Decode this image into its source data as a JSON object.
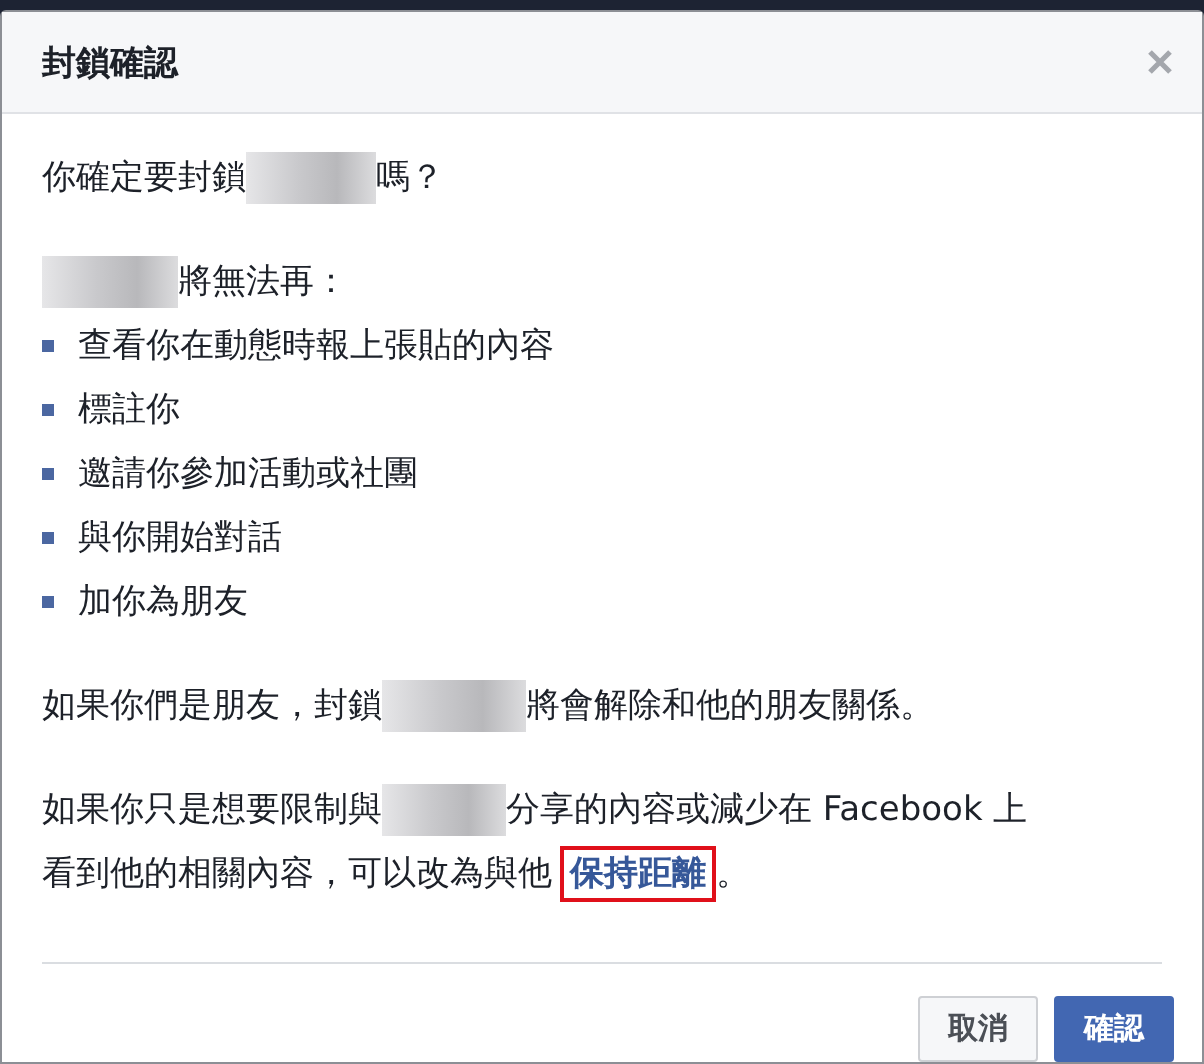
{
  "dialog": {
    "title": "封鎖確認",
    "question": {
      "before": "你確定要封鎖",
      "after": "嗎？"
    },
    "list_intro": {
      "after": "將無法再："
    },
    "items": [
      "查看你在動態時報上張貼的內容",
      "標註你",
      "邀請你參加活動或社團",
      "與你開始對話",
      "加你為朋友"
    ],
    "friends_note": {
      "before": "如果你們是朋友，封鎖",
      "after": "將會解除和他的朋友關係。"
    },
    "limit_note": {
      "before": "如果你只是想要限制與",
      "after": "分享的內容或減少在 Facebook 上",
      "next_line": "看到他的相關內容，可以改為與他",
      "link": "保持距離",
      "end": "。"
    },
    "buttons": [
      {
        "label": "取消",
        "kind": "secondary"
      },
      {
        "label": "確認",
        "kind": "primary"
      }
    ]
  }
}
